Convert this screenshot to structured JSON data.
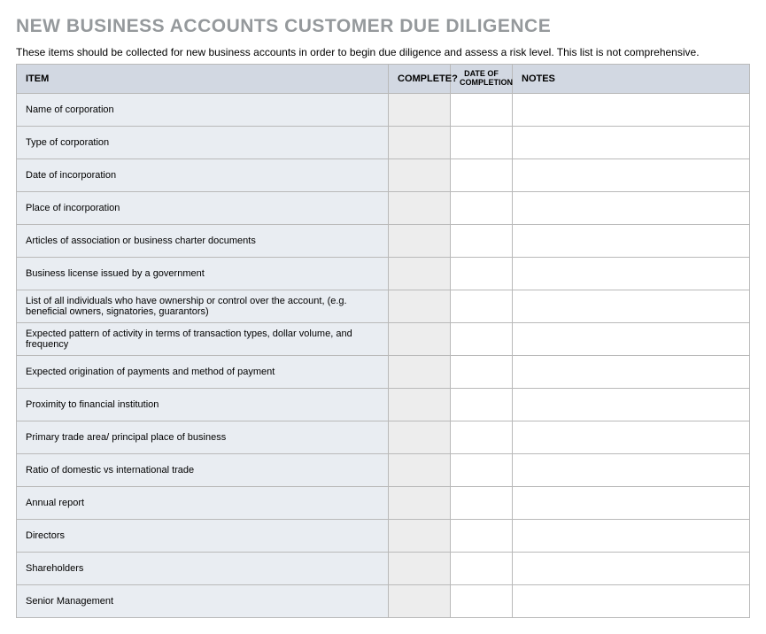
{
  "title": "NEW BUSINESS ACCOUNTS CUSTOMER DUE DILIGENCE",
  "subtitle": "These items should be collected for new business accounts in order to begin due diligence and assess a risk level. This list is not comprehensive.",
  "headers": {
    "item": "ITEM",
    "complete": "COMPLETE?",
    "date": "DATE OF COMPLETION",
    "notes": "NOTES"
  },
  "rows": [
    {
      "item": "Name of corporation",
      "complete": "",
      "date": "",
      "notes": ""
    },
    {
      "item": "Type of corporation",
      "complete": "",
      "date": "",
      "notes": ""
    },
    {
      "item": "Date of incorporation",
      "complete": "",
      "date": "",
      "notes": ""
    },
    {
      "item": "Place of incorporation",
      "complete": "",
      "date": "",
      "notes": ""
    },
    {
      "item": "Articles of association or business charter documents",
      "complete": "",
      "date": "",
      "notes": ""
    },
    {
      "item": "Business license issued by a government",
      "complete": "",
      "date": "",
      "notes": ""
    },
    {
      "item": "List of all individuals who have ownership or control over the account, (e.g. beneficial owners, signatories, guarantors)",
      "complete": "",
      "date": "",
      "notes": ""
    },
    {
      "item": "Expected pattern of activity in terms of transaction types, dollar volume, and frequency",
      "complete": "",
      "date": "",
      "notes": ""
    },
    {
      "item": "Expected origination of payments and method of payment",
      "complete": "",
      "date": "",
      "notes": ""
    },
    {
      "item": "Proximity to financial institution",
      "complete": "",
      "date": "",
      "notes": ""
    },
    {
      "item": "Primary trade area/ principal place of business",
      "complete": "",
      "date": "",
      "notes": ""
    },
    {
      "item": "Ratio of domestic vs international trade",
      "complete": "",
      "date": "",
      "notes": ""
    },
    {
      "item": "Annual report",
      "complete": "",
      "date": "",
      "notes": ""
    },
    {
      "item": "Directors",
      "complete": "",
      "date": "",
      "notes": ""
    },
    {
      "item": "Shareholders",
      "complete": "",
      "date": "",
      "notes": ""
    },
    {
      "item": "Senior Management",
      "complete": "",
      "date": "",
      "notes": ""
    }
  ]
}
